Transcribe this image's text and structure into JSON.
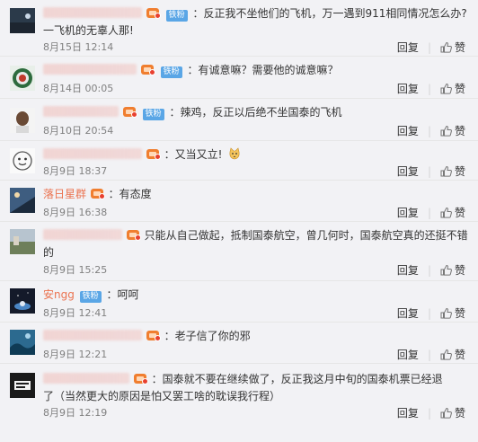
{
  "actions": {
    "reply": "回复",
    "like": "赞",
    "separator": "|"
  },
  "fan_badge": "铁粉",
  "comments": [
    {
      "username": "",
      "text": "：反正我不坐他们的飞机，万一遇到911相同情况怎么办?",
      "text2": "一飞机的无辜人那!",
      "time": "8月15日 12:14"
    },
    {
      "username": "",
      "text": "：有诚意嘛？需要他的诚意嘛？",
      "time": "8月14日 00:05"
    },
    {
      "username": "",
      "text": "：辣鸡，反正以后绝不坐国泰的飞机",
      "time": "8月10日 20:54"
    },
    {
      "username": "",
      "text": "：又当又立!",
      "time": "8月9日 18:37"
    },
    {
      "username": "落日星群",
      "text": "：有态度",
      "time": "8月9日 16:38"
    },
    {
      "username": "",
      "text": "只能从自己做起，抵制国泰航空，曾几何时，国泰航空真的还挺不错",
      "text2": "的",
      "time": "8月9日 15:25"
    },
    {
      "username": "安ngg",
      "text": "：呵呵",
      "time": "8月9日 12:41"
    },
    {
      "username": "",
      "text": "：老子信了你的邪",
      "time": "8月9日 12:21"
    },
    {
      "username": "",
      "text": "：国泰就不要在继续做了，反正我这月中旬的国泰机票已经退",
      "text2": "了（当然更大的原因是怕又罢工啥的耽误我行程）",
      "time": "8月9日 12:19"
    }
  ]
}
